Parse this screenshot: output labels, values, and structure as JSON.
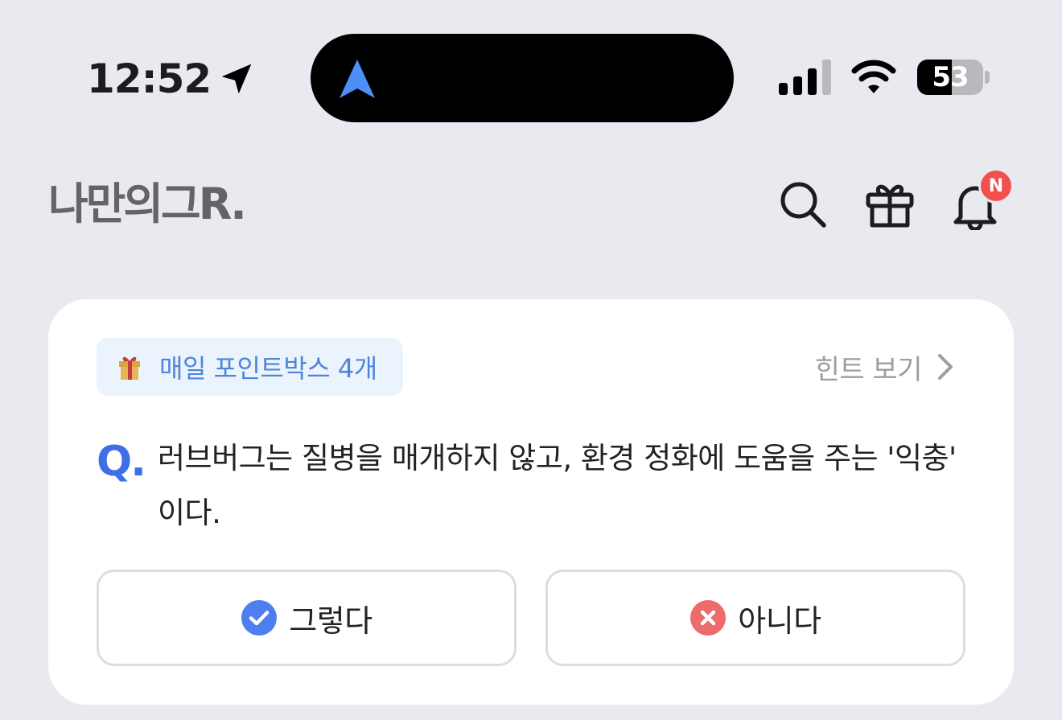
{
  "status_bar": {
    "time": "12:52",
    "battery_level": "53",
    "battery_fraction": 0.53
  },
  "header": {
    "logo_text": "나만의그R.",
    "notification_badge": "N"
  },
  "quiz": {
    "chip_label": "매일 포인트박스 4개",
    "hint_label": "힌트 보기",
    "q_mark": "Q.",
    "question": "러브버그는 질병을 매개하지 않고, 환경 정화에 도움을 주는 '익충' 이다.",
    "yes_label": "그렇다",
    "no_label": "아니다"
  },
  "colors": {
    "background": "#e9eaf0",
    "accent_blue": "#3f6ee8",
    "chip_background": "#ebf3fd",
    "chip_text": "#4f85d9",
    "badge_red": "#f0514e",
    "no_red": "#ed6b6b"
  },
  "icons": {
    "location": "location-arrow-icon",
    "island": "navigation-arrow-icon",
    "signal": "signal-icon",
    "wifi": "wifi-icon",
    "battery": "battery-icon",
    "search": "search-icon",
    "gift": "gift-icon",
    "bell": "bell-icon",
    "chip": "gift-emoji-icon",
    "hint": "chevron-right-icon",
    "yes": "check-circle-icon",
    "no": "x-circle-icon"
  }
}
